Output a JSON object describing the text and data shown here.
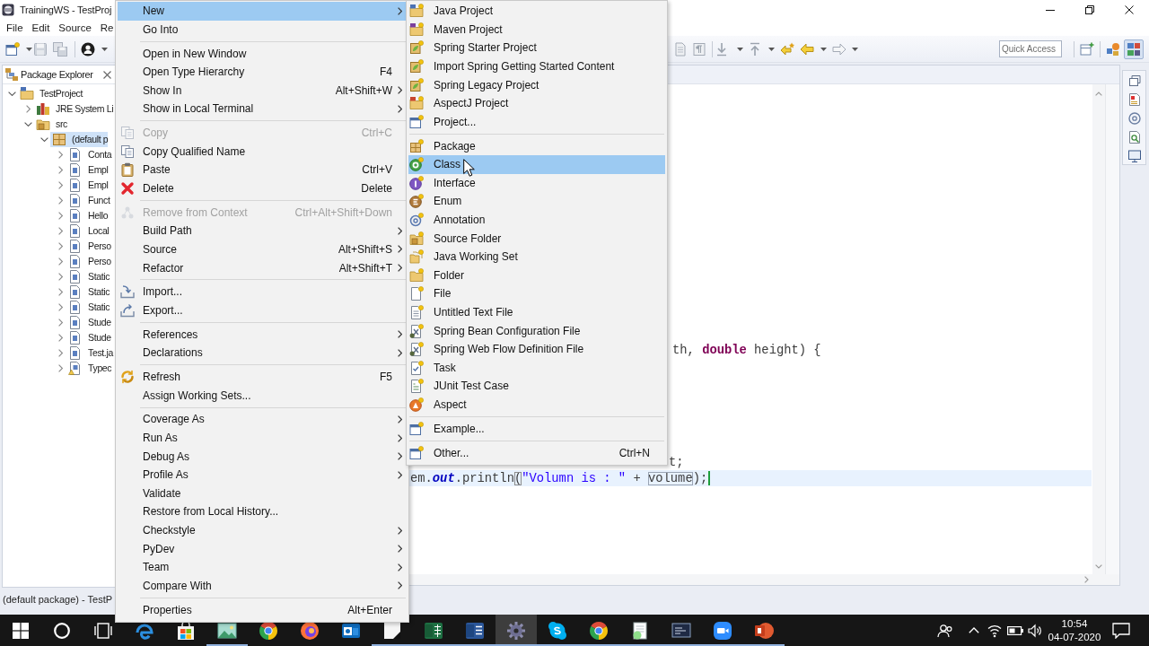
{
  "window": {
    "title": "TrainingWS - TestProj"
  },
  "menu_bar": [
    "File",
    "Edit",
    "Source",
    "Re"
  ],
  "toolbar": {
    "quick_access": {
      "placeholder": "Quick Access"
    },
    "perspectives": [
      {
        "kind": "shapes",
        "selected": false
      },
      {
        "kind": "blocks",
        "selected": true
      }
    ]
  },
  "package_explorer": {
    "title": "Package Explorer",
    "tree": [
      {
        "label": "TestProject",
        "kind": "project",
        "expanded": true,
        "selected": false,
        "children": [
          {
            "label": "JRE System Li",
            "kind": "library",
            "expanded": false,
            "selected": false
          },
          {
            "label": "src",
            "kind": "source",
            "expanded": true,
            "selected": false,
            "children": [
              {
                "label": "(default p",
                "kind": "package",
                "expanded": true,
                "selected": true,
                "children": [
                  {
                    "label": "Conta",
                    "kind": "java",
                    "expanded": false,
                    "selected": false
                  },
                  {
                    "label": "Empl",
                    "kind": "java",
                    "expanded": false,
                    "selected": false
                  },
                  {
                    "label": "Empl",
                    "kind": "java",
                    "expanded": false,
                    "selected": false
                  },
                  {
                    "label": "Funct",
                    "kind": "java",
                    "expanded": false,
                    "selected": false
                  },
                  {
                    "label": "Hello",
                    "kind": "java",
                    "expanded": false,
                    "selected": false
                  },
                  {
                    "label": "Local",
                    "kind": "java",
                    "expanded": false,
                    "selected": false
                  },
                  {
                    "label": "Perso",
                    "kind": "java",
                    "expanded": false,
                    "selected": false
                  },
                  {
                    "label": "Perso",
                    "kind": "java",
                    "expanded": false,
                    "selected": false
                  },
                  {
                    "label": "Static",
                    "kind": "java",
                    "expanded": false,
                    "selected": false
                  },
                  {
                    "label": "Static",
                    "kind": "java",
                    "expanded": false,
                    "selected": false
                  },
                  {
                    "label": "Static",
                    "kind": "java",
                    "expanded": false,
                    "selected": false
                  },
                  {
                    "label": "Stude",
                    "kind": "java",
                    "expanded": false,
                    "selected": false
                  },
                  {
                    "label": "Stude",
                    "kind": "java",
                    "expanded": false,
                    "selected": false
                  },
                  {
                    "label": "Test.ja",
                    "kind": "java",
                    "expanded": false,
                    "selected": false
                  },
                  {
                    "label": "Typec",
                    "kind": "java-warning",
                    "expanded": false,
                    "selected": false
                  }
                ]
              }
            ]
          }
        ]
      }
    ]
  },
  "editor": {
    "lines": [
      {
        "current": false,
        "tokens": [
          {
            "kind": "plain",
            "text": "th, "
          },
          {
            "kind": "keyword",
            "text": "double"
          },
          {
            "kind": "plain",
            "text": " height) {"
          }
        ]
      },
      {
        "current": false,
        "tokens": [
          {
            "kind": "plain",
            "text": "t;"
          }
        ]
      },
      {
        "current": true,
        "tokens": [
          {
            "kind": "plain",
            "text": "em."
          },
          {
            "kind": "field",
            "text": "out"
          },
          {
            "kind": "plain",
            "text": ".println"
          },
          {
            "kind": "match",
            "text": "("
          },
          {
            "kind": "string",
            "text": "\"Volumn is : \""
          },
          {
            "kind": "plain",
            "text": " + "
          },
          {
            "kind": "occurrence",
            "text": "volume"
          },
          {
            "kind": "plain",
            "text": ");"
          }
        ]
      }
    ]
  },
  "status_bar": {
    "text": "(default package) - TestP"
  },
  "context_menu": {
    "groups": [
      {
        "items": [
          {
            "kind": "plain",
            "label": "New",
            "submenu": true,
            "selected": true,
            "disabled": false
          },
          {
            "kind": "plain",
            "label": "Go Into",
            "submenu": false,
            "selected": false,
            "disabled": false
          }
        ]
      },
      {
        "items": [
          {
            "kind": "plain",
            "label": "Open in New Window",
            "submenu": false,
            "selected": false,
            "disabled": false
          },
          {
            "kind": "plain",
            "label": "Open Type Hierarchy",
            "shortcut": "F4",
            "submenu": false,
            "selected": false,
            "disabled": false
          },
          {
            "kind": "plain",
            "label": "Show In",
            "shortcut": "Alt+Shift+W",
            "submenu": true,
            "selected": false,
            "disabled": false
          },
          {
            "kind": "plain",
            "label": "Show in Local Terminal",
            "submenu": true,
            "selected": false,
            "disabled": false
          }
        ]
      },
      {
        "items": [
          {
            "kind": "copy",
            "label": "Copy",
            "shortcut": "Ctrl+C",
            "submenu": false,
            "selected": false,
            "disabled": true
          },
          {
            "kind": "copy",
            "label": "Copy Qualified Name",
            "submenu": false,
            "selected": false,
            "disabled": false
          },
          {
            "kind": "paste",
            "label": "Paste",
            "shortcut": "Ctrl+V",
            "submenu": false,
            "selected": false,
            "disabled": false
          },
          {
            "kind": "delete",
            "label": "Delete",
            "shortcut": "Delete",
            "submenu": false,
            "selected": false,
            "disabled": false
          }
        ]
      },
      {
        "items": [
          {
            "kind": "remove",
            "label": "Remove from Context",
            "shortcut": "Ctrl+Alt+Shift+Down",
            "submenu": false,
            "selected": false,
            "disabled": true
          },
          {
            "kind": "plain",
            "label": "Build Path",
            "submenu": true,
            "selected": false,
            "disabled": false
          },
          {
            "kind": "plain",
            "label": "Source",
            "shortcut": "Alt+Shift+S",
            "submenu": true,
            "selected": false,
            "disabled": false
          },
          {
            "kind": "plain",
            "label": "Refactor",
            "shortcut": "Alt+Shift+T",
            "submenu": true,
            "selected": false,
            "disabled": false
          }
        ]
      },
      {
        "items": [
          {
            "kind": "import",
            "label": "Import...",
            "submenu": false,
            "selected": false,
            "disabled": false
          },
          {
            "kind": "export",
            "label": "Export...",
            "submenu": false,
            "selected": false,
            "disabled": false
          }
        ]
      },
      {
        "items": [
          {
            "kind": "plain",
            "label": "References",
            "submenu": true,
            "selected": false,
            "disabled": false
          },
          {
            "kind": "plain",
            "label": "Declarations",
            "submenu": true,
            "selected": false,
            "disabled": false
          }
        ]
      },
      {
        "items": [
          {
            "kind": "refresh",
            "label": "Refresh",
            "shortcut": "F5",
            "submenu": false,
            "selected": false,
            "disabled": false
          },
          {
            "kind": "plain",
            "label": "Assign Working Sets...",
            "submenu": false,
            "selected": false,
            "disabled": false
          }
        ]
      },
      {
        "items": [
          {
            "kind": "plain",
            "label": "Coverage As",
            "submenu": true,
            "selected": false,
            "disabled": false
          },
          {
            "kind": "plain",
            "label": "Run As",
            "submenu": true,
            "selected": false,
            "disabled": false
          },
          {
            "kind": "plain",
            "label": "Debug As",
            "submenu": true,
            "selected": false,
            "disabled": false
          },
          {
            "kind": "plain",
            "label": "Profile As",
            "submenu": true,
            "selected": false,
            "disabled": false
          },
          {
            "kind": "plain",
            "label": "Validate",
            "submenu": false,
            "selected": false,
            "disabled": false
          },
          {
            "kind": "plain",
            "label": "Restore from Local History...",
            "submenu": false,
            "selected": false,
            "disabled": false
          },
          {
            "kind": "plain",
            "label": "Checkstyle",
            "submenu": true,
            "selected": false,
            "disabled": false
          },
          {
            "kind": "plain",
            "label": "PyDev",
            "submenu": true,
            "selected": false,
            "disabled": false
          },
          {
            "kind": "plain",
            "label": "Team",
            "submenu": true,
            "selected": false,
            "disabled": false
          },
          {
            "kind": "plain",
            "label": "Compare With",
            "submenu": true,
            "selected": false,
            "disabled": false
          }
        ]
      },
      {
        "items": [
          {
            "kind": "plain",
            "label": "Properties",
            "shortcut": "Alt+Enter",
            "submenu": false,
            "selected": false,
            "disabled": false
          }
        ]
      }
    ]
  },
  "new_submenu": {
    "groups": [
      {
        "items": [
          {
            "kind": "java-project",
            "label": "Java Project",
            "selected": false
          },
          {
            "kind": "maven-project",
            "label": "Maven Project",
            "selected": false
          },
          {
            "kind": "spring-project",
            "label": "Spring Starter Project",
            "selected": false
          },
          {
            "kind": "spring-project",
            "label": "Import Spring Getting Started Content",
            "selected": false
          },
          {
            "kind": "spring-project",
            "label": "Spring Legacy Project",
            "selected": false
          },
          {
            "kind": "aspectj-project",
            "label": "AspectJ Project",
            "selected": false
          },
          {
            "kind": "wizard",
            "label": "Project...",
            "selected": false
          }
        ]
      },
      {
        "items": [
          {
            "kind": "package",
            "label": "Package",
            "selected": false
          },
          {
            "kind": "class",
            "label": "Class",
            "selected": true
          },
          {
            "kind": "interface",
            "label": "Interface",
            "selected": false
          },
          {
            "kind": "enum",
            "label": "Enum",
            "selected": false
          },
          {
            "kind": "annotation",
            "label": "Annotation",
            "selected": false
          },
          {
            "kind": "source-folder",
            "label": "Source Folder",
            "selected": false
          },
          {
            "kind": "working-set",
            "label": "Java Working Set",
            "selected": false
          },
          {
            "kind": "folder",
            "label": "Folder",
            "selected": false
          },
          {
            "kind": "file",
            "label": "File",
            "selected": false
          },
          {
            "kind": "text-file",
            "label": "Untitled Text File",
            "selected": false
          },
          {
            "kind": "xml-file",
            "label": "Spring Bean Configuration File",
            "selected": false
          },
          {
            "kind": "xml-file",
            "label": "Spring Web Flow Definition File",
            "selected": false
          },
          {
            "kind": "task",
            "label": "Task",
            "selected": false
          },
          {
            "kind": "test-file",
            "label": "JUnit Test Case",
            "selected": false
          },
          {
            "kind": "aspect",
            "label": "Aspect",
            "selected": false
          }
        ]
      },
      {
        "items": [
          {
            "kind": "wizard",
            "label": "Example...",
            "selected": false
          }
        ]
      },
      {
        "items": [
          {
            "kind": "wizard",
            "label": "Other...",
            "shortcut": "Ctrl+N",
            "selected": false
          }
        ]
      }
    ]
  },
  "taskbar": {
    "apps": [
      {
        "kind": "swirl",
        "open": false,
        "selected": false
      },
      {
        "kind": "bag",
        "open": false,
        "selected": false
      },
      {
        "kind": "landscape",
        "open": true,
        "selected": false
      },
      {
        "kind": "pinwheel",
        "open": false,
        "selected": false
      },
      {
        "kind": "globe",
        "open": false,
        "selected": false
      },
      {
        "kind": "envelope",
        "open": false,
        "selected": false
      },
      {
        "kind": "note",
        "open": true,
        "selected": false
      },
      {
        "kind": "sheet",
        "open": true,
        "selected": false
      },
      {
        "kind": "doc",
        "open": true,
        "selected": false
      },
      {
        "kind": "gear",
        "open": true,
        "selected": true
      },
      {
        "kind": "bubble",
        "open": true,
        "selected": false
      },
      {
        "kind": "pinwheel",
        "open": true,
        "selected": false
      },
      {
        "kind": "pad",
        "open": true,
        "selected": false
      },
      {
        "kind": "monitor",
        "open": true,
        "selected": false
      },
      {
        "kind": "camera",
        "open": true,
        "selected": false
      },
      {
        "kind": "slides",
        "open": true,
        "selected": false
      }
    ],
    "clock": {
      "time": "10:54",
      "date": "04-07-2020"
    }
  }
}
